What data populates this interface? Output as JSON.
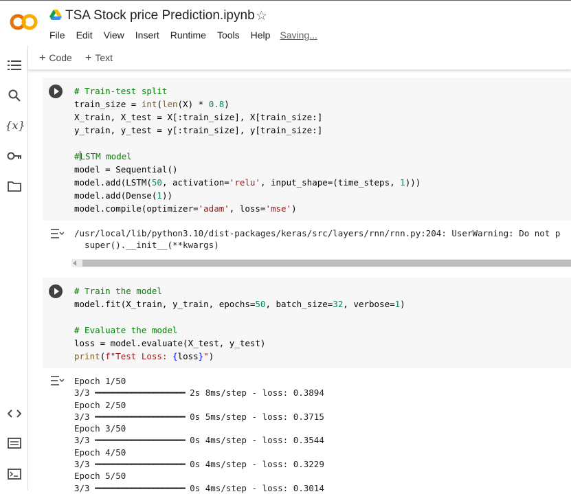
{
  "app": {
    "title": "TSA Stock price Prediction.ipynb",
    "logo": "colab-logo",
    "brand_colors": {
      "logo_orange": "#F9AB00",
      "logo_dark": "#E8710A"
    }
  },
  "menu": {
    "file": "File",
    "edit": "Edit",
    "view": "View",
    "insert": "Insert",
    "runtime": "Runtime",
    "tools": "Tools",
    "help": "Help",
    "status": "Saving..."
  },
  "toolbar": {
    "add_code": "Code",
    "add_text": "Text"
  },
  "sidebar": {
    "icons": [
      "toc-icon",
      "search-icon",
      "variables-icon",
      "key-icon",
      "folder-icon",
      "code-snippets-icon",
      "command-palette-icon",
      "terminal-icon"
    ],
    "variables_glyph": "{x}"
  },
  "cell1": {
    "lines": [
      "# Train-test split",
      "train_size = int(len(X) * 0.8)",
      "X_train, X_test = X[:train_size], X[train_size:]",
      "y_train, y_test = y[:train_size], y[train_size:]",
      "",
      "#LSTM model",
      "model = Sequential()",
      "model.add(LSTM(50, activation='relu', input_shape=(time_steps, 1)))",
      "model.add(Dense(1))",
      "model.compile(optimizer='adam', loss='mse')"
    ],
    "output": [
      "/usr/local/lib/python3.10/dist-packages/keras/src/layers/rnn/rnn.py:204: UserWarning: Do not p",
      "  super().__init__(**kwargs)"
    ]
  },
  "cell2": {
    "lines": [
      "# Train the model",
      "model.fit(X_train, y_train, epochs=50, batch_size=32, verbose=1)",
      "",
      "# Evaluate the model",
      "loss = model.evaluate(X_test, y_test)",
      "print(f\"Test Loss: {loss}\")"
    ],
    "output": [
      {
        "epoch": "Epoch 1/50",
        "step": "3/3",
        "time": "2s",
        "per_step": "8ms/step",
        "loss": "loss: 0.3894"
      },
      {
        "epoch": "Epoch 2/50",
        "step": "3/3",
        "time": "0s",
        "per_step": "5ms/step",
        "loss": "loss: 0.3715"
      },
      {
        "epoch": "Epoch 3/50",
        "step": "3/3",
        "time": "0s",
        "per_step": "4ms/step",
        "loss": "loss: 0.3544"
      },
      {
        "epoch": "Epoch 4/50",
        "step": "3/3",
        "time": "0s",
        "per_step": "4ms/step",
        "loss": "loss: 0.3229"
      },
      {
        "epoch": "Epoch 5/50",
        "step": "3/3",
        "time": "0s",
        "per_step": "4ms/step",
        "loss": "loss: 0.3014"
      }
    ]
  },
  "progress_bar_text": "━━━━━━━━━━━━━━━━━━━━"
}
